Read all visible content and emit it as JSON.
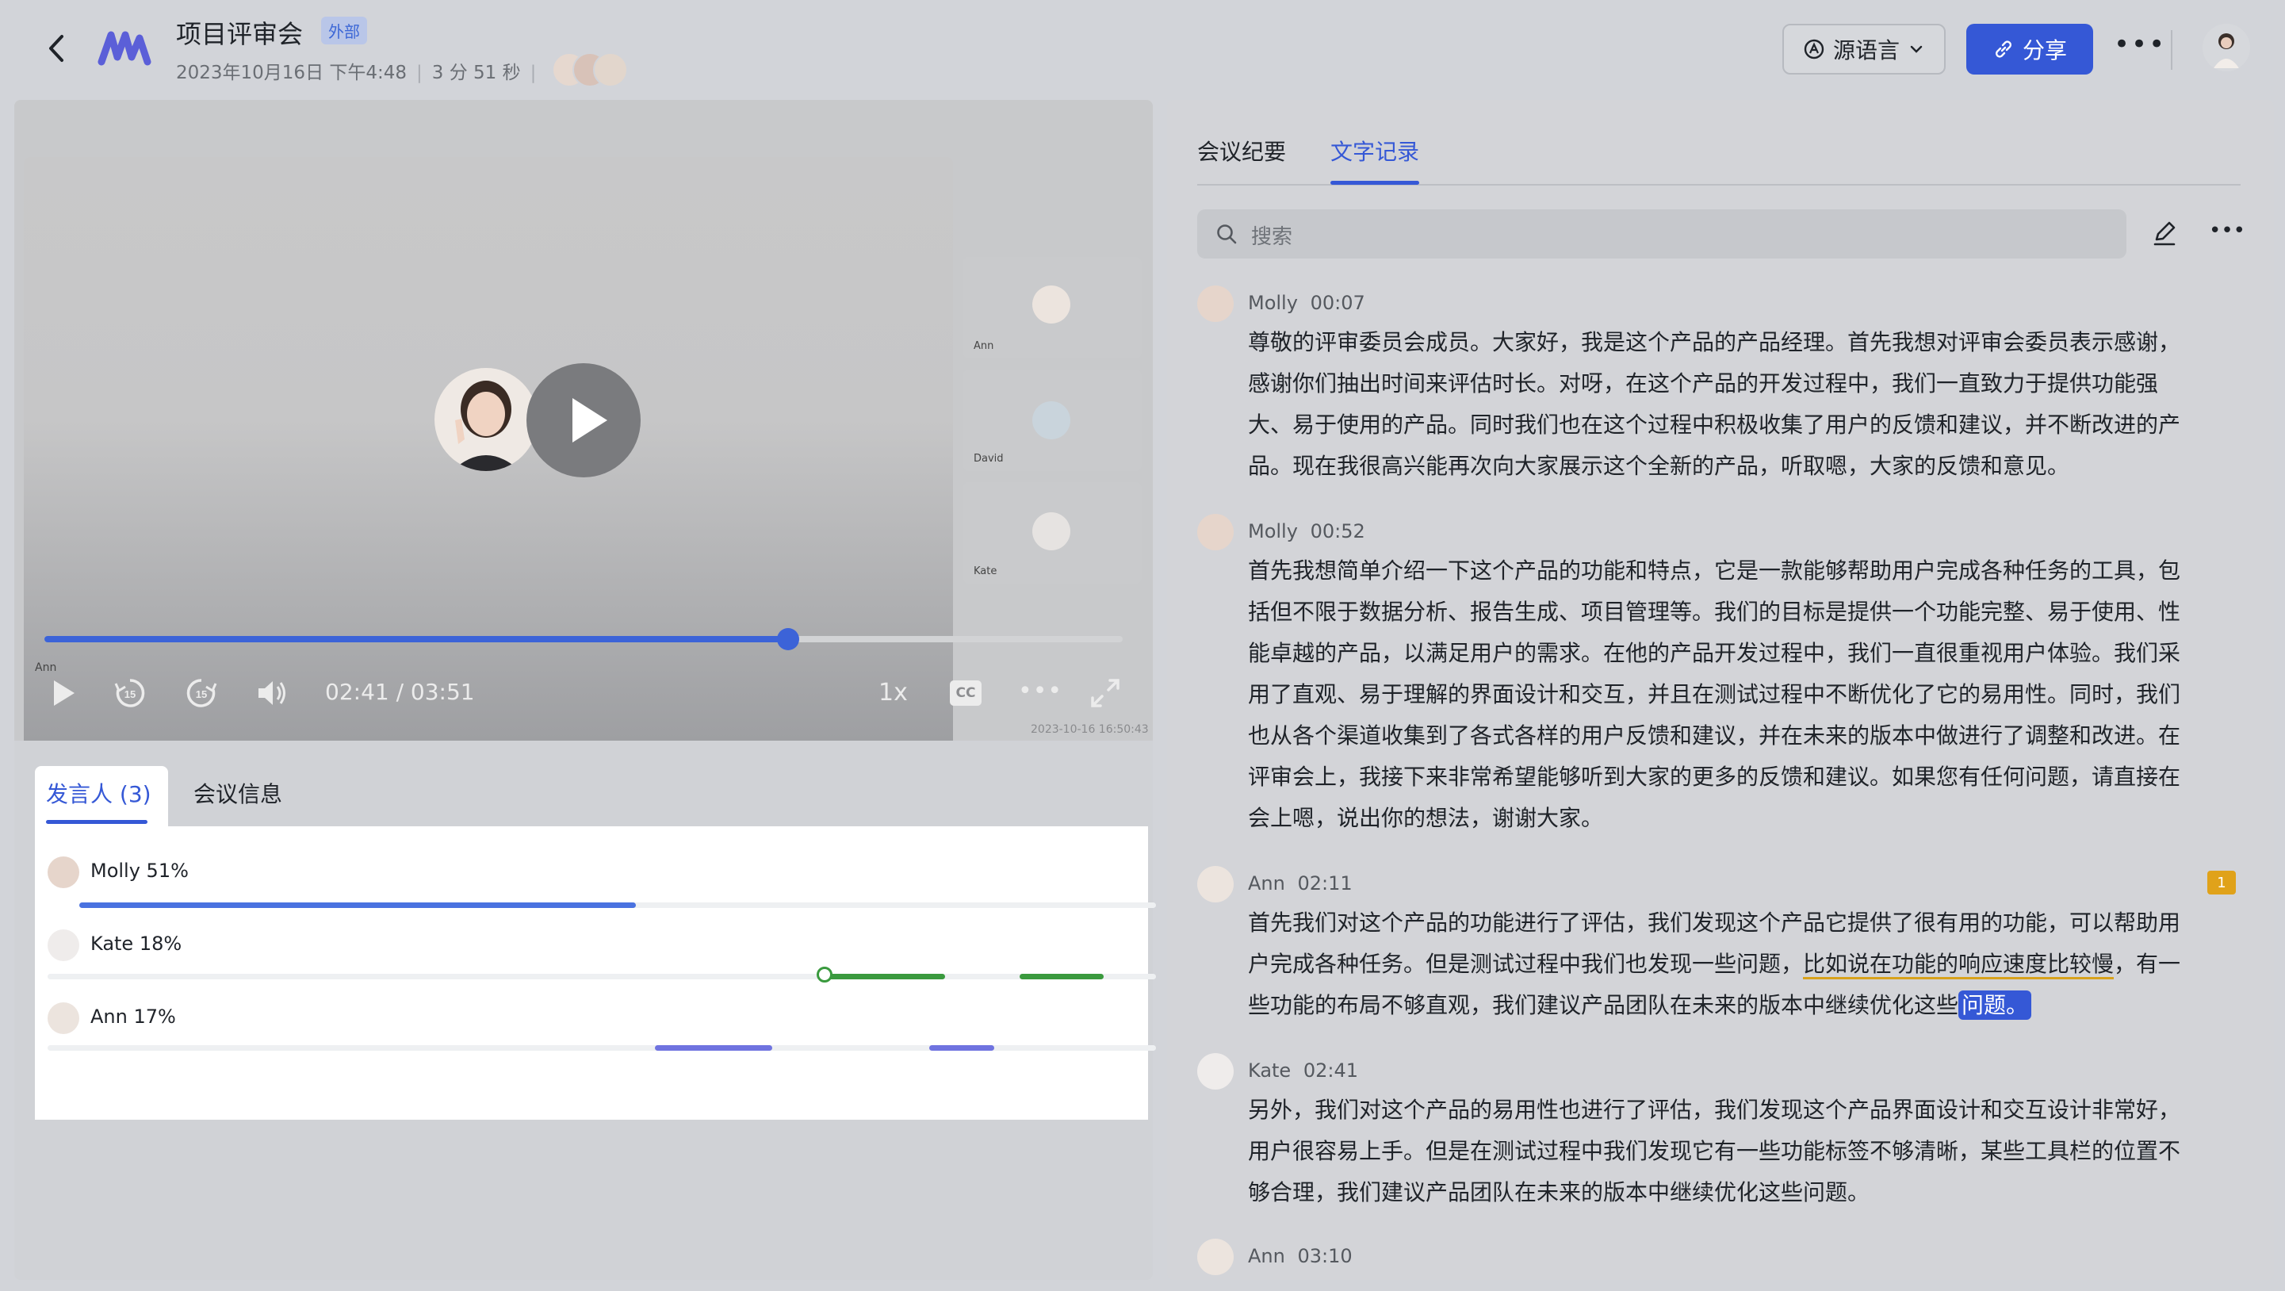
{
  "header": {
    "title": "项目评审会",
    "badge": "外部",
    "date": "2023年10月16日 下午4:48",
    "duration": "3 分 51 秒",
    "lang_button": "源语言",
    "share_button": "分享"
  },
  "video": {
    "time_display": "02:41 / 03:51",
    "speed": "1x",
    "cc": "CC",
    "progress": 0.69,
    "main_label": "Ann",
    "watermark": "2023-10-16 16:50:43",
    "participants": [
      {
        "name": "Ann"
      },
      {
        "name": "David"
      },
      {
        "name": "Kate"
      }
    ]
  },
  "speakers": {
    "tabs": [
      "发言人 (3)",
      "会议信息"
    ],
    "list": [
      {
        "label": "Molly 51%",
        "color": "#4a72e0"
      },
      {
        "label": "Kate 18%",
        "color": "#3a9a3e"
      },
      {
        "label": "Ann 17%",
        "color": "#6f73e0"
      }
    ]
  },
  "transcript": {
    "tabs": [
      "会议纪要",
      "文字记录"
    ],
    "search_placeholder": "搜索",
    "comment_count": "1",
    "messages": [
      {
        "speaker": "Molly",
        "time": "00:07",
        "text": "尊敬的评审委员会成员。大家好，我是这个产品的产品经理。首先我想对评审会委员表示感谢，感谢你们抽出时间来评估时长。对呀，在这个产品的开发过程中，我们一直致力于提供功能强大、易于使用的产品。同时我们也在这个过程中积极收集了用户的反馈和建议，并不断改进的产品。现在我很高兴能再次向大家展示这个全新的产品，听取嗯，大家的反馈和意见。"
      },
      {
        "speaker": "Molly",
        "time": "00:52",
        "text": "首先我想简单介绍一下这个产品的功能和特点，它是一款能够帮助用户完成各种任务的工具，包括但不限于数据分析、报告生成、项目管理等。我们的目标是提供一个功能完整、易于使用、性能卓越的产品，以满足用户的需求。在他的产品开发过程中，我们一直很重视用户体验。我们采用了直观、易于理解的界面设计和交互，并且在测试过程中不断优化了它的易用性。同时，我们也从各个渠道收集到了各式各样的用户反馈和建议，并在未来的版本中做进行了调整和改进。在评审会上，我接下来非常希望能够听到大家的更多的反馈和建议。如果您有任何问题，请直接在会上嗯，说出你的想法，谢谢大家。"
      },
      {
        "speaker": "Ann",
        "time": "02:11",
        "text_a": "首先我们对这个产品的功能进行了评估，我们发现这个产品它提供了很有用的功能，可以帮助用户完成各种任务。但是测试过程中我们也发现一些问题，",
        "text_highlight": "比如说在功能的响应速度比较慢",
        "text_b": "，有一些功能的布局不够直观，我们建议产品团队在未来的版本中继续优化这些",
        "text_selected": "问题。"
      },
      {
        "speaker": "Kate",
        "time": "02:41",
        "text": "另外，我们对这个产品的易用性也进行了评估，我们发现这个产品界面设计和交互设计非常好，用户很容易上手。但是在测试过程中我们发现它有一些功能标签不够清晰，某些工具栏的位置不够合理，我们建议产品团队在未来的版本中继续优化这些问题。"
      },
      {
        "speaker": "Ann",
        "time": "03:10",
        "text": ""
      }
    ]
  }
}
